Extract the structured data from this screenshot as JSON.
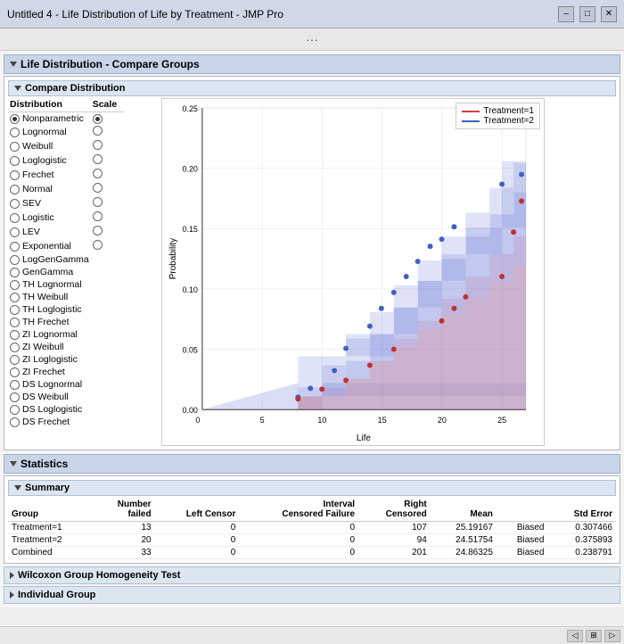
{
  "window": {
    "title": "Untitled 4 - Life Distribution of Life by Treatment - JMP Pro",
    "menu_dots": "···"
  },
  "controls": {
    "minimize": "–",
    "maximize": "□",
    "close": "✕"
  },
  "main_section": {
    "title": "Life Distribution - Compare Groups"
  },
  "compare_distribution": {
    "title": "Compare Distribution",
    "col_distribution": "Distribution",
    "col_scale": "Scale",
    "rows": [
      {
        "label": "Nonparametric",
        "selected": true
      },
      {
        "label": "Lognormal",
        "selected": false
      },
      {
        "label": "Weibull",
        "selected": false
      },
      {
        "label": "Loglogistic",
        "selected": false
      },
      {
        "label": "Frechet",
        "selected": false
      },
      {
        "label": "Normal",
        "selected": false
      },
      {
        "label": "SEV",
        "selected": false
      },
      {
        "label": "Logistic",
        "selected": false
      },
      {
        "label": "LEV",
        "selected": false
      },
      {
        "label": "Exponential",
        "selected": false
      },
      {
        "label": "LogGenGamma",
        "selected": false
      },
      {
        "label": "GenGamma",
        "selected": false
      },
      {
        "label": "TH Lognormal",
        "selected": false
      },
      {
        "label": "TH Weibull",
        "selected": false
      },
      {
        "label": "TH Loglogistic",
        "selected": false
      },
      {
        "label": "TH Frechet",
        "selected": false
      },
      {
        "label": "ZI Lognormal",
        "selected": false
      },
      {
        "label": "ZI Weibull",
        "selected": false
      },
      {
        "label": "ZI Loglogistic",
        "selected": false
      },
      {
        "label": "ZI Frechet",
        "selected": false
      },
      {
        "label": "DS Lognormal",
        "selected": false
      },
      {
        "label": "DS Weibull",
        "selected": false
      },
      {
        "label": "DS Loglogistic",
        "selected": false
      },
      {
        "label": "DS Frechet",
        "selected": false
      }
    ]
  },
  "chart": {
    "x_label": "Life",
    "y_label": "Probability",
    "x_ticks": [
      "0",
      "5",
      "10",
      "15",
      "20",
      "25"
    ],
    "y_ticks": [
      "0.00",
      "0.05",
      "0.10",
      "0.15",
      "0.20",
      "0.25"
    ],
    "legend": [
      {
        "label": "Treatment=1",
        "color": "#d04040"
      },
      {
        "label": "Treatment=2",
        "color": "#4060c0"
      }
    ]
  },
  "statistics": {
    "title": "Statistics",
    "summary_title": "Summary",
    "columns": [
      "Group",
      "Number failed",
      "Left Censor",
      "Interval Censored Failure",
      "Right Censored",
      "Mean",
      "",
      "Std Error"
    ],
    "rows": [
      {
        "group": "Treatment=1",
        "num_failed": 13,
        "left_censor": 0,
        "interval": 0,
        "right_censored": 107,
        "mean": "25.19167",
        "biased": "Biased",
        "std_error": "0.307466"
      },
      {
        "group": "Treatment=2",
        "num_failed": 20,
        "left_censor": 0,
        "interval": 0,
        "right_censored": 94,
        "mean": "24.51754",
        "biased": "Biased",
        "std_error": "0.375893"
      },
      {
        "group": "Combined",
        "num_failed": 33,
        "left_censor": 0,
        "interval": 0,
        "right_censored": 201,
        "mean": "24.86325",
        "biased": "Biased",
        "std_error": "0.238791"
      }
    ]
  },
  "wilcoxon_btn": "Wilcoxon Group Homogeneity Test",
  "individual_group_btn": "Individual Group"
}
